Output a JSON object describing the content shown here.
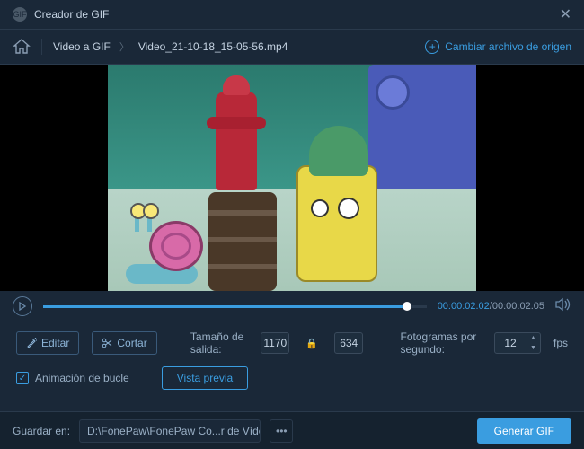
{
  "titlebar": {
    "title": "Creador de GIF"
  },
  "nav": {
    "crumb1": "Video a GIF",
    "crumb2": "Video_21-10-18_15-05-56.mp4",
    "change_source": "Cambiar archivo de origen"
  },
  "player": {
    "current": "00:00:02.02",
    "total": "00:00:02.05"
  },
  "controls": {
    "edit": "Editar",
    "cut": "Cortar",
    "size_label": "Tamaño de salida:",
    "width": "1170",
    "height": "634",
    "fps_label": "Fotogramas por segundo:",
    "fps_value": "12",
    "fps_unit": "fps",
    "loop": "Animación de bucle",
    "preview": "Vista previa"
  },
  "footer": {
    "save_label": "Guardar en:",
    "path": "D:\\FonePaw\\FonePaw Co...r de Vídeos\\GIF Maker",
    "generate": "Generar GIF"
  }
}
